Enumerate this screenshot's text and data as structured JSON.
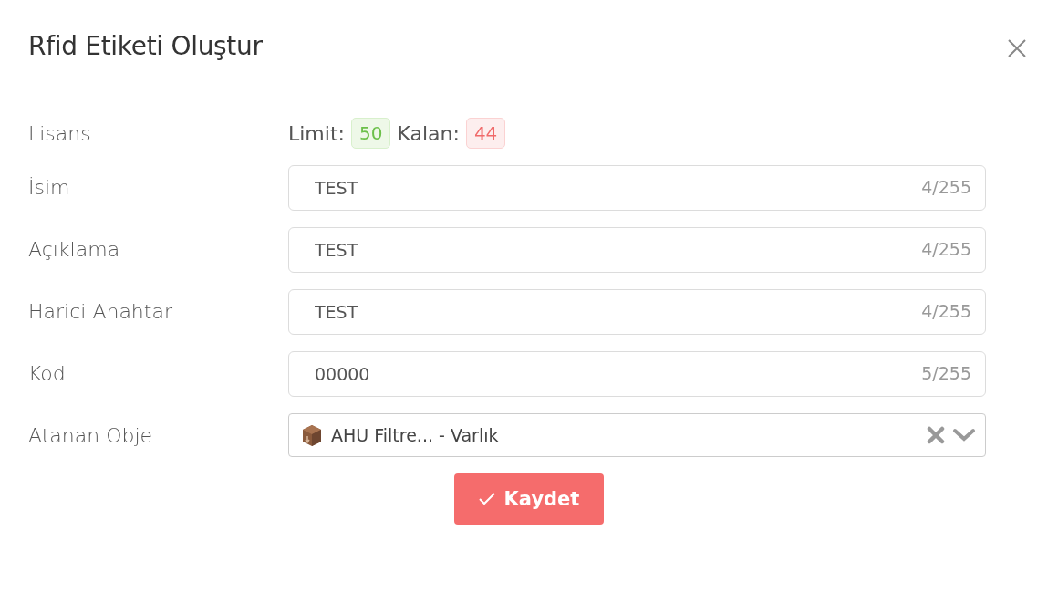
{
  "dialog": {
    "title": "Rfid Etiketi Oluştur"
  },
  "license": {
    "label": "Lisans",
    "limit_label": "Limit:",
    "limit": "50",
    "remaining_label": "Kalan:",
    "remaining": "44"
  },
  "fields": [
    {
      "label": "İsim",
      "value": "TEST",
      "counter": "4/255"
    },
    {
      "label": "Açıklama",
      "value": "TEST",
      "counter": "4/255"
    },
    {
      "label": "Harici Anahtar",
      "value": "TEST",
      "counter": "4/255"
    },
    {
      "label": "Kod",
      "value": "00000",
      "counter": "5/255"
    }
  ],
  "assigned": {
    "label": "Atanan Obje",
    "value": "AHU Filtre... - Varlık"
  },
  "save_button": "Kaydet"
}
